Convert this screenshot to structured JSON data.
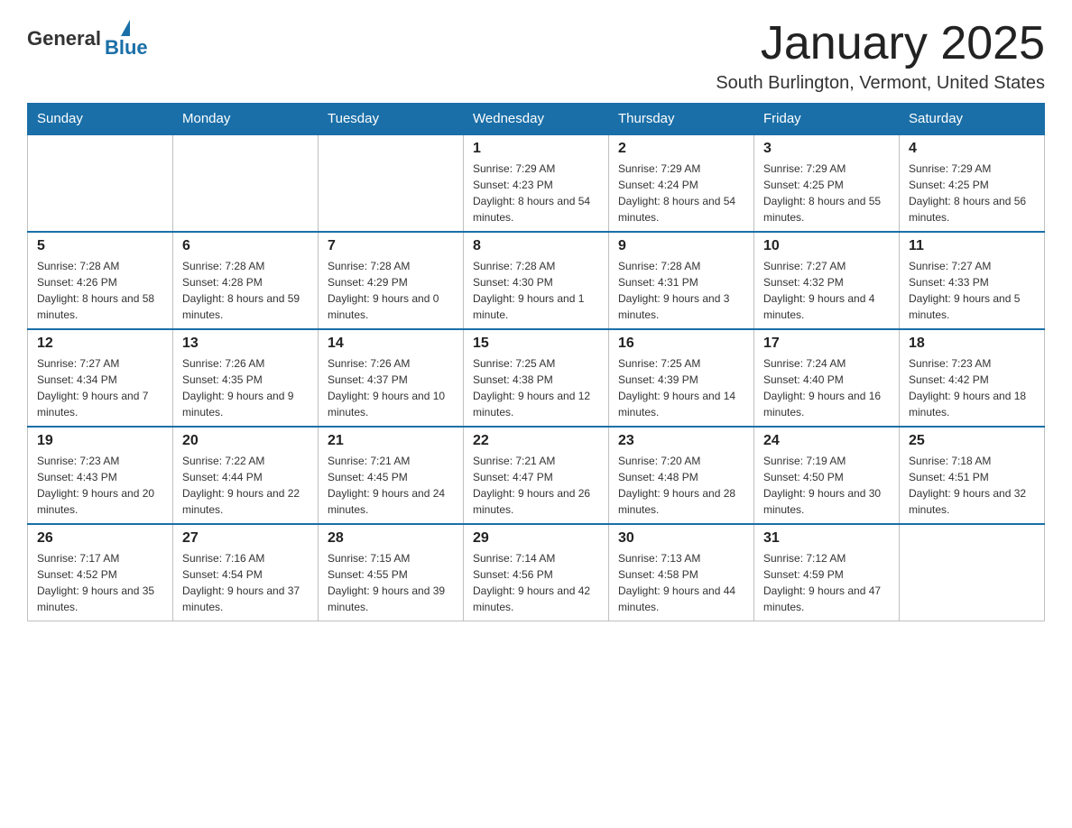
{
  "header": {
    "logo_general": "General",
    "logo_blue": "Blue",
    "month_title": "January 2025",
    "location": "South Burlington, Vermont, United States"
  },
  "days_of_week": [
    "Sunday",
    "Monday",
    "Tuesday",
    "Wednesday",
    "Thursday",
    "Friday",
    "Saturday"
  ],
  "weeks": [
    [
      {
        "day": "",
        "sunrise": "",
        "sunset": "",
        "daylight": ""
      },
      {
        "day": "",
        "sunrise": "",
        "sunset": "",
        "daylight": ""
      },
      {
        "day": "",
        "sunrise": "",
        "sunset": "",
        "daylight": ""
      },
      {
        "day": "1",
        "sunrise": "Sunrise: 7:29 AM",
        "sunset": "Sunset: 4:23 PM",
        "daylight": "Daylight: 8 hours and 54 minutes."
      },
      {
        "day": "2",
        "sunrise": "Sunrise: 7:29 AM",
        "sunset": "Sunset: 4:24 PM",
        "daylight": "Daylight: 8 hours and 54 minutes."
      },
      {
        "day": "3",
        "sunrise": "Sunrise: 7:29 AM",
        "sunset": "Sunset: 4:25 PM",
        "daylight": "Daylight: 8 hours and 55 minutes."
      },
      {
        "day": "4",
        "sunrise": "Sunrise: 7:29 AM",
        "sunset": "Sunset: 4:25 PM",
        "daylight": "Daylight: 8 hours and 56 minutes."
      }
    ],
    [
      {
        "day": "5",
        "sunrise": "Sunrise: 7:28 AM",
        "sunset": "Sunset: 4:26 PM",
        "daylight": "Daylight: 8 hours and 58 minutes."
      },
      {
        "day": "6",
        "sunrise": "Sunrise: 7:28 AM",
        "sunset": "Sunset: 4:28 PM",
        "daylight": "Daylight: 8 hours and 59 minutes."
      },
      {
        "day": "7",
        "sunrise": "Sunrise: 7:28 AM",
        "sunset": "Sunset: 4:29 PM",
        "daylight": "Daylight: 9 hours and 0 minutes."
      },
      {
        "day": "8",
        "sunrise": "Sunrise: 7:28 AM",
        "sunset": "Sunset: 4:30 PM",
        "daylight": "Daylight: 9 hours and 1 minute."
      },
      {
        "day": "9",
        "sunrise": "Sunrise: 7:28 AM",
        "sunset": "Sunset: 4:31 PM",
        "daylight": "Daylight: 9 hours and 3 minutes."
      },
      {
        "day": "10",
        "sunrise": "Sunrise: 7:27 AM",
        "sunset": "Sunset: 4:32 PM",
        "daylight": "Daylight: 9 hours and 4 minutes."
      },
      {
        "day": "11",
        "sunrise": "Sunrise: 7:27 AM",
        "sunset": "Sunset: 4:33 PM",
        "daylight": "Daylight: 9 hours and 5 minutes."
      }
    ],
    [
      {
        "day": "12",
        "sunrise": "Sunrise: 7:27 AM",
        "sunset": "Sunset: 4:34 PM",
        "daylight": "Daylight: 9 hours and 7 minutes."
      },
      {
        "day": "13",
        "sunrise": "Sunrise: 7:26 AM",
        "sunset": "Sunset: 4:35 PM",
        "daylight": "Daylight: 9 hours and 9 minutes."
      },
      {
        "day": "14",
        "sunrise": "Sunrise: 7:26 AM",
        "sunset": "Sunset: 4:37 PM",
        "daylight": "Daylight: 9 hours and 10 minutes."
      },
      {
        "day": "15",
        "sunrise": "Sunrise: 7:25 AM",
        "sunset": "Sunset: 4:38 PM",
        "daylight": "Daylight: 9 hours and 12 minutes."
      },
      {
        "day": "16",
        "sunrise": "Sunrise: 7:25 AM",
        "sunset": "Sunset: 4:39 PM",
        "daylight": "Daylight: 9 hours and 14 minutes."
      },
      {
        "day": "17",
        "sunrise": "Sunrise: 7:24 AM",
        "sunset": "Sunset: 4:40 PM",
        "daylight": "Daylight: 9 hours and 16 minutes."
      },
      {
        "day": "18",
        "sunrise": "Sunrise: 7:23 AM",
        "sunset": "Sunset: 4:42 PM",
        "daylight": "Daylight: 9 hours and 18 minutes."
      }
    ],
    [
      {
        "day": "19",
        "sunrise": "Sunrise: 7:23 AM",
        "sunset": "Sunset: 4:43 PM",
        "daylight": "Daylight: 9 hours and 20 minutes."
      },
      {
        "day": "20",
        "sunrise": "Sunrise: 7:22 AM",
        "sunset": "Sunset: 4:44 PM",
        "daylight": "Daylight: 9 hours and 22 minutes."
      },
      {
        "day": "21",
        "sunrise": "Sunrise: 7:21 AM",
        "sunset": "Sunset: 4:45 PM",
        "daylight": "Daylight: 9 hours and 24 minutes."
      },
      {
        "day": "22",
        "sunrise": "Sunrise: 7:21 AM",
        "sunset": "Sunset: 4:47 PM",
        "daylight": "Daylight: 9 hours and 26 minutes."
      },
      {
        "day": "23",
        "sunrise": "Sunrise: 7:20 AM",
        "sunset": "Sunset: 4:48 PM",
        "daylight": "Daylight: 9 hours and 28 minutes."
      },
      {
        "day": "24",
        "sunrise": "Sunrise: 7:19 AM",
        "sunset": "Sunset: 4:50 PM",
        "daylight": "Daylight: 9 hours and 30 minutes."
      },
      {
        "day": "25",
        "sunrise": "Sunrise: 7:18 AM",
        "sunset": "Sunset: 4:51 PM",
        "daylight": "Daylight: 9 hours and 32 minutes."
      }
    ],
    [
      {
        "day": "26",
        "sunrise": "Sunrise: 7:17 AM",
        "sunset": "Sunset: 4:52 PM",
        "daylight": "Daylight: 9 hours and 35 minutes."
      },
      {
        "day": "27",
        "sunrise": "Sunrise: 7:16 AM",
        "sunset": "Sunset: 4:54 PM",
        "daylight": "Daylight: 9 hours and 37 minutes."
      },
      {
        "day": "28",
        "sunrise": "Sunrise: 7:15 AM",
        "sunset": "Sunset: 4:55 PM",
        "daylight": "Daylight: 9 hours and 39 minutes."
      },
      {
        "day": "29",
        "sunrise": "Sunrise: 7:14 AM",
        "sunset": "Sunset: 4:56 PM",
        "daylight": "Daylight: 9 hours and 42 minutes."
      },
      {
        "day": "30",
        "sunrise": "Sunrise: 7:13 AM",
        "sunset": "Sunset: 4:58 PM",
        "daylight": "Daylight: 9 hours and 44 minutes."
      },
      {
        "day": "31",
        "sunrise": "Sunrise: 7:12 AM",
        "sunset": "Sunset: 4:59 PM",
        "daylight": "Daylight: 9 hours and 47 minutes."
      },
      {
        "day": "",
        "sunrise": "",
        "sunset": "",
        "daylight": ""
      }
    ]
  ]
}
